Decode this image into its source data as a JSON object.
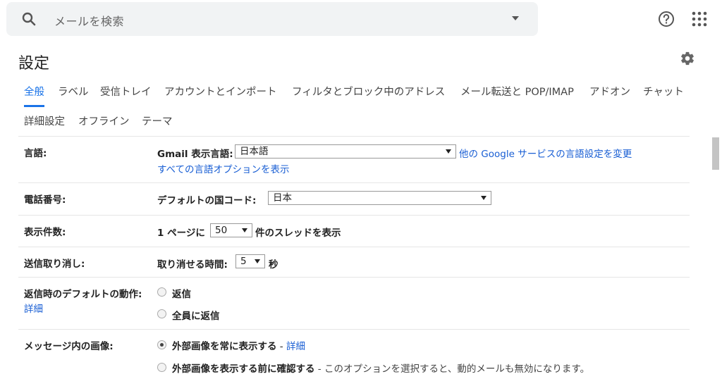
{
  "search": {
    "placeholder": "メールを検索"
  },
  "header": {
    "title": "設定"
  },
  "tabs": [
    {
      "label": "全般",
      "active": true
    },
    {
      "label": "ラベル"
    },
    {
      "label": "受信トレイ"
    },
    {
      "label": "アカウントとインポート"
    },
    {
      "label": "フィルタとブロック中のアドレス"
    },
    {
      "label": "メール転送と POP/IMAP"
    },
    {
      "label": "アドオン"
    },
    {
      "label": "チャット"
    },
    {
      "label": "詳細設定"
    },
    {
      "label": "オフライン"
    },
    {
      "label": "テーマ"
    }
  ],
  "settings": {
    "language": {
      "label": "言語:",
      "field_label": "Gmail 表示言語:",
      "value": "日本語",
      "link": "他の Google サービスの言語設定を変更",
      "link2": "すべての言語オプションを表示"
    },
    "phone": {
      "label": "電話番号:",
      "field_label": "デフォルトの国コード:",
      "value": "日本"
    },
    "page_size": {
      "label": "表示件数:",
      "prefix": "1 ページに",
      "value": "50",
      "suffix": "件のスレッドを表示"
    },
    "undo_send": {
      "label": "送信取り消し:",
      "field_label": "取り消せる時間:",
      "value": "5",
      "suffix": "秒"
    },
    "reply_default": {
      "label": "返信時のデフォルトの動作:",
      "detail_link": "詳細",
      "options": [
        "返信",
        "全員に返信"
      ]
    },
    "images": {
      "label": "メッセージ内の画像:",
      "option1": "外部画像を常に表示する",
      "option1_sep": " - ",
      "option1_link": "詳細",
      "option2": "外部画像を表示する前に確認する",
      "option2_desc": " - このオプションを選択すると、動的メールも無効になります。"
    }
  },
  "colors": {
    "accent": "#1a73e8",
    "link": "#1a5fd4"
  }
}
